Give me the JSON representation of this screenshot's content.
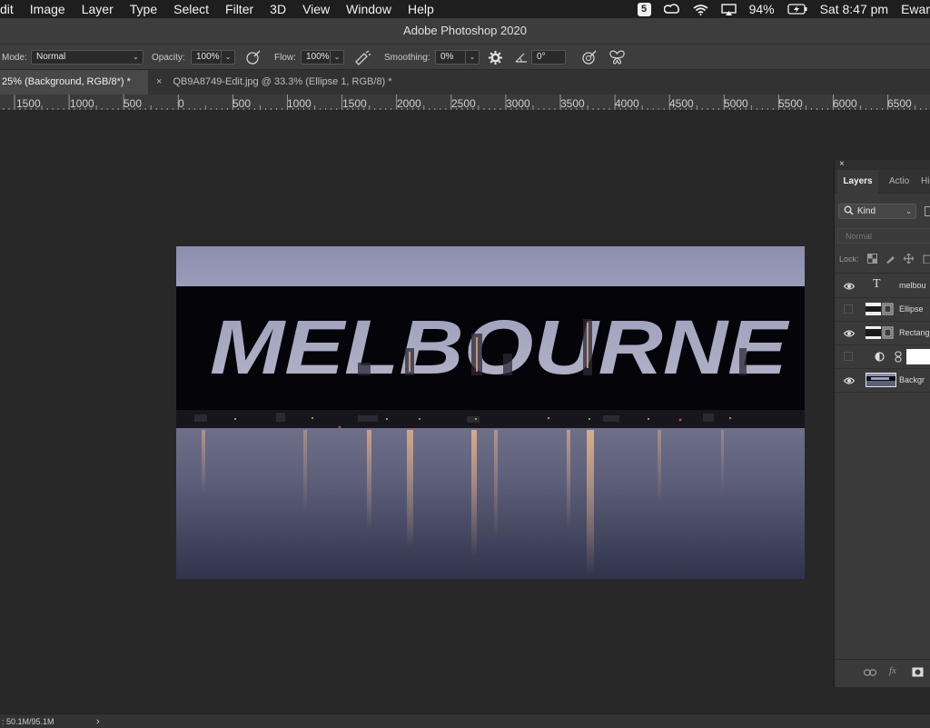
{
  "menubar": {
    "items": [
      "dit",
      "Image",
      "Layer",
      "Type",
      "Select",
      "Filter",
      "3D",
      "View",
      "Window",
      "Help"
    ],
    "status": {
      "badge": "5",
      "battery": "94%",
      "clock": "Sat 8:47 pm",
      "user": "Ewar"
    }
  },
  "titlebar": {
    "title": "Adobe Photoshop 2020"
  },
  "options": {
    "mode_label": "Mode:",
    "mode_value": "Normal",
    "opacity_label": "Opacity:",
    "opacity_value": "100%",
    "flow_label": "Flow:",
    "flow_value": "100%",
    "smoothing_label": "Smoothing:",
    "smoothing_value": "0%",
    "angle_value": "0°"
  },
  "tabs": [
    {
      "label": "25% (Background, RGB/8*) *",
      "active": true
    },
    {
      "label": "QB9A8749-Edit.jpg @ 33.3% (Ellipse 1, RGB/8) *",
      "active": false
    }
  ],
  "ruler": {
    "labels": [
      "1500",
      "1000",
      "500",
      "0",
      "500",
      "1000",
      "1500",
      "2000",
      "2500",
      "3000",
      "3500",
      "4000",
      "4500",
      "5000",
      "5500",
      "6000",
      "6500"
    ]
  },
  "document": {
    "text": "MELBOURNE"
  },
  "layers_panel": {
    "tabs": [
      "Layers",
      "Actio",
      "Hi"
    ],
    "kind_label": "Kind",
    "blend_mode": "Normal",
    "lock_label": "Lock:",
    "layers": [
      {
        "name": "melbou",
        "visible": true,
        "type": "text"
      },
      {
        "name": "Ellipse",
        "visible": false,
        "type": "shape"
      },
      {
        "name": "Rectang",
        "visible": true,
        "type": "shape"
      },
      {
        "name": "",
        "visible": false,
        "type": "adjustment"
      },
      {
        "name": "Backgr",
        "visible": true,
        "type": "image"
      }
    ]
  },
  "statusbar": {
    "doc_size": ": 50.1M/95.1M",
    "arrow": "›"
  }
}
